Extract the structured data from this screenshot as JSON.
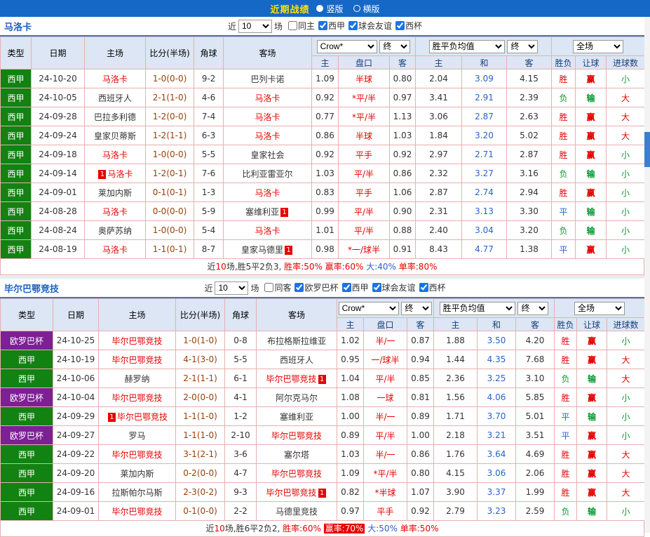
{
  "topbar": {
    "title": "近期战绩",
    "options": [
      {
        "label": "竖版",
        "selected": true
      },
      {
        "label": "横版",
        "selected": false
      }
    ]
  },
  "colors": {
    "accent_blue": "#1568c6",
    "league_green": "#128212",
    "league_purple": "#7c2093",
    "win_red": "#e60000",
    "lose_green": "#089a33",
    "draw_blue": "#2b62c9"
  },
  "sections": [
    {
      "team": "马洛卡",
      "filters": {
        "near": "近",
        "count": "10",
        "unit": "场",
        "checkboxes": [
          {
            "label": "同主",
            "checked": false
          },
          {
            "label": "西甲",
            "checked": true
          },
          {
            "label": "球会友谊",
            "checked": true
          },
          {
            "label": "西杯",
            "checked": true
          }
        ]
      },
      "header": {
        "type": "类型",
        "date": "日期",
        "home": "主场",
        "score": "比分(半场)",
        "corner": "角球",
        "away": "客场",
        "bookmaker": "Crow*",
        "bookmaker_stage": "终",
        "avg": "胜平负均值",
        "avg_stage": "终",
        "scope": "全场",
        "sub": [
          "主",
          "盘口",
          "客",
          "主",
          "和",
          "客",
          "胜负",
          "让球",
          "进球数"
        ]
      },
      "rows": [
        {
          "lg": "西甲",
          "lgc": "g",
          "date": "24-10-20",
          "home": {
            "name": "马洛卡",
            "focus": true
          },
          "score": "1-0(0-0)",
          "corner": "9-2",
          "away": {
            "name": "巴列卡诺"
          },
          "o": [
            "1.09",
            "半球",
            "0.80"
          ],
          "e": [
            "2.04",
            "3.09",
            "4.15"
          ],
          "res": [
            "胜",
            "r"
          ],
          "cov": [
            "赢",
            "r"
          ],
          "big": [
            "小",
            "g"
          ]
        },
        {
          "lg": "西甲",
          "lgc": "g",
          "date": "24-10-05",
          "home": {
            "name": "西班牙人"
          },
          "score": "2-1(1-0)",
          "corner": "4-6",
          "away": {
            "name": "马洛卡",
            "focus": true
          },
          "o": [
            "0.92",
            "*平/半",
            "0.97"
          ],
          "e": [
            "3.41",
            "2.91",
            "2.39"
          ],
          "res": [
            "负",
            "g"
          ],
          "cov": [
            "输",
            "g"
          ],
          "big": [
            "大",
            "r"
          ]
        },
        {
          "lg": "西甲",
          "lgc": "g",
          "date": "24-09-28",
          "home": {
            "name": "巴拉多利德"
          },
          "score": "1-2(0-0)",
          "corner": "7-4",
          "away": {
            "name": "马洛卡",
            "focus": true
          },
          "o": [
            "0.77",
            "*平/半",
            "1.13"
          ],
          "e": [
            "3.06",
            "2.87",
            "2.63"
          ],
          "res": [
            "胜",
            "r"
          ],
          "cov": [
            "赢",
            "r"
          ],
          "big": [
            "大",
            "r"
          ]
        },
        {
          "lg": "西甲",
          "lgc": "g",
          "date": "24-09-24",
          "home": {
            "name": "皇家贝蒂斯"
          },
          "score": "1-2(1-1)",
          "corner": "6-3",
          "away": {
            "name": "马洛卡",
            "focus": true
          },
          "o": [
            "0.86",
            "半球",
            "1.03"
          ],
          "e": [
            "1.84",
            "3.20",
            "5.02"
          ],
          "res": [
            "胜",
            "r"
          ],
          "cov": [
            "赢",
            "r"
          ],
          "big": [
            "大",
            "r"
          ]
        },
        {
          "lg": "西甲",
          "lgc": "g",
          "date": "24-09-18",
          "home": {
            "name": "马洛卡",
            "focus": true
          },
          "score": "1-0(0-0)",
          "corner": "5-5",
          "away": {
            "name": "皇家社会"
          },
          "o": [
            "0.92",
            "平手",
            "0.92"
          ],
          "e": [
            "2.97",
            "2.71",
            "2.87"
          ],
          "res": [
            "胜",
            "r"
          ],
          "cov": [
            "赢",
            "r"
          ],
          "big": [
            "小",
            "g"
          ]
        },
        {
          "lg": "西甲",
          "lgc": "g",
          "date": "24-09-14",
          "home": {
            "name": "马洛卡",
            "focus": true,
            "pre": "1"
          },
          "score": "1-2(0-1)",
          "corner": "7-6",
          "away": {
            "name": "比利亚雷亚尔"
          },
          "o": [
            "1.03",
            "平/半",
            "0.86"
          ],
          "e": [
            "2.32",
            "3.27",
            "3.16"
          ],
          "res": [
            "负",
            "g"
          ],
          "cov": [
            "输",
            "g"
          ],
          "big": [
            "小",
            "g"
          ]
        },
        {
          "lg": "西甲",
          "lgc": "g",
          "date": "24-09-01",
          "home": {
            "name": "莱加内斯"
          },
          "score": "0-1(0-1)",
          "corner": "1-3",
          "away": {
            "name": "马洛卡",
            "focus": true
          },
          "o": [
            "0.83",
            "平手",
            "1.06"
          ],
          "e": [
            "2.87",
            "2.74",
            "2.94"
          ],
          "res": [
            "胜",
            "r"
          ],
          "cov": [
            "赢",
            "r"
          ],
          "big": [
            "小",
            "g"
          ]
        },
        {
          "lg": "西甲",
          "lgc": "g",
          "date": "24-08-28",
          "home": {
            "name": "马洛卡",
            "focus": true
          },
          "score": "0-0(0-0)",
          "corner": "5-9",
          "away": {
            "name": "塞维利亚",
            "post": "1"
          },
          "o": [
            "0.99",
            "平/半",
            "0.90"
          ],
          "e": [
            "2.31",
            "3.13",
            "3.30"
          ],
          "res": [
            "平",
            "b"
          ],
          "cov": [
            "输",
            "g"
          ],
          "big": [
            "小",
            "g"
          ]
        },
        {
          "lg": "西甲",
          "lgc": "g",
          "date": "24-08-24",
          "home": {
            "name": "奥萨苏纳"
          },
          "score": "1-0(0-0)",
          "corner": "5-4",
          "away": {
            "name": "马洛卡",
            "focus": true
          },
          "o": [
            "1.01",
            "平/半",
            "0.88"
          ],
          "e": [
            "2.40",
            "3.04",
            "3.20"
          ],
          "res": [
            "负",
            "g"
          ],
          "cov": [
            "输",
            "g"
          ],
          "big": [
            "小",
            "g"
          ]
        },
        {
          "lg": "西甲",
          "lgc": "g",
          "date": "24-08-19",
          "home": {
            "name": "马洛卡",
            "focus": true
          },
          "score": "1-1(0-1)",
          "corner": "8-7",
          "away": {
            "name": "皇家马德里",
            "post": "1"
          },
          "o": [
            "0.98",
            "*一/球半",
            "0.91"
          ],
          "e": [
            "8.43",
            "4.77",
            "1.38"
          ],
          "res": [
            "平",
            "b"
          ],
          "cov": [
            "赢",
            "r"
          ],
          "big": [
            "小",
            "g"
          ]
        }
      ],
      "summary": [
        {
          "text": "近",
          "c": "k"
        },
        {
          "text": "10",
          "c": "r"
        },
        {
          "text": "场,胜5平2负3, ",
          "c": "k"
        },
        {
          "text": "胜率:50%",
          "c": "r"
        },
        {
          "text": " 赢率:60%",
          "c": "r"
        },
        {
          "text": " 大:40%",
          "c": "b"
        },
        {
          "text": " 单率:80%",
          "c": "r"
        }
      ]
    },
    {
      "team": "毕尔巴鄂竞技",
      "filters": {
        "near": "近",
        "count": "10",
        "unit": "场",
        "checkboxes": [
          {
            "label": "同客",
            "checked": false
          },
          {
            "label": "欧罗巴杯",
            "checked": true
          },
          {
            "label": "西甲",
            "checked": true
          },
          {
            "label": "球会友谊",
            "checked": true
          },
          {
            "label": "西杯",
            "checked": true
          }
        ]
      },
      "header": {
        "type": "类型",
        "date": "日期",
        "home": "主场",
        "score": "比分(半场)",
        "corner": "角球",
        "away": "客场",
        "bookmaker": "Crow*",
        "bookmaker_stage": "终",
        "avg": "胜平负均值",
        "avg_stage": "终",
        "scope": "全场",
        "sub": [
          "主",
          "盘口",
          "客",
          "主",
          "和",
          "客",
          "胜负",
          "让球",
          "进球数"
        ]
      },
      "rows": [
        {
          "lg": "欧罗巴杯",
          "lgc": "p",
          "date": "24-10-25",
          "home": {
            "name": "毕尔巴鄂竞技",
            "focus": true
          },
          "score": "1-0(1-0)",
          "corner": "0-8",
          "away": {
            "name": "布拉格斯拉维亚"
          },
          "o": [
            "1.02",
            "半/一",
            "0.87"
          ],
          "e": [
            "1.88",
            "3.50",
            "4.20"
          ],
          "res": [
            "胜",
            "r"
          ],
          "cov": [
            "赢",
            "r"
          ],
          "big": [
            "小",
            "g"
          ]
        },
        {
          "lg": "西甲",
          "lgc": "g",
          "date": "24-10-19",
          "home": {
            "name": "毕尔巴鄂竞技",
            "focus": true
          },
          "score": "4-1(3-0)",
          "corner": "5-5",
          "away": {
            "name": "西班牙人"
          },
          "o": [
            "0.95",
            "一/球半",
            "0.94"
          ],
          "e": [
            "1.44",
            "4.35",
            "7.68"
          ],
          "res": [
            "胜",
            "r"
          ],
          "cov": [
            "赢",
            "r"
          ],
          "big": [
            "大",
            "r"
          ]
        },
        {
          "lg": "西甲",
          "lgc": "g",
          "date": "24-10-06",
          "home": {
            "name": "赫罗纳"
          },
          "score": "2-1(1-1)",
          "corner": "6-1",
          "away": {
            "name": "毕尔巴鄂竞技",
            "focus": true,
            "post": "1"
          },
          "o": [
            "1.04",
            "平/半",
            "0.85"
          ],
          "e": [
            "2.36",
            "3.25",
            "3.10"
          ],
          "res": [
            "负",
            "g"
          ],
          "cov": [
            "输",
            "g"
          ],
          "big": [
            "大",
            "r"
          ]
        },
        {
          "lg": "欧罗巴杯",
          "lgc": "p",
          "date": "24-10-04",
          "home": {
            "name": "毕尔巴鄂竞技",
            "focus": true
          },
          "score": "2-0(0-0)",
          "corner": "4-1",
          "away": {
            "name": "阿尔克马尔"
          },
          "o": [
            "1.08",
            "一球",
            "0.81"
          ],
          "e": [
            "1.56",
            "4.06",
            "5.85"
          ],
          "res": [
            "胜",
            "r"
          ],
          "cov": [
            "赢",
            "r"
          ],
          "big": [
            "小",
            "g"
          ]
        },
        {
          "lg": "西甲",
          "lgc": "g",
          "date": "24-09-29",
          "home": {
            "name": "毕尔巴鄂竞技",
            "focus": true,
            "pre": "1"
          },
          "score": "1-1(1-0)",
          "corner": "1-2",
          "away": {
            "name": "塞维利亚"
          },
          "o": [
            "1.00",
            "半/一",
            "0.89"
          ],
          "e": [
            "1.71",
            "3.70",
            "5.01"
          ],
          "res": [
            "平",
            "b"
          ],
          "cov": [
            "输",
            "g"
          ],
          "big": [
            "小",
            "g"
          ]
        },
        {
          "lg": "欧罗巴杯",
          "lgc": "p",
          "date": "24-09-27",
          "home": {
            "name": "罗马"
          },
          "score": "1-1(1-0)",
          "corner": "2-10",
          "away": {
            "name": "毕尔巴鄂竞技",
            "focus": true
          },
          "o": [
            "0.89",
            "平/半",
            "1.00"
          ],
          "e": [
            "2.18",
            "3.21",
            "3.51"
          ],
          "res": [
            "平",
            "b"
          ],
          "cov": [
            "赢",
            "r"
          ],
          "big": [
            "小",
            "g"
          ]
        },
        {
          "lg": "西甲",
          "lgc": "g",
          "date": "24-09-22",
          "home": {
            "name": "毕尔巴鄂竞技",
            "focus": true
          },
          "score": "3-1(2-1)",
          "corner": "3-6",
          "away": {
            "name": "塞尔塔"
          },
          "o": [
            "1.03",
            "半/一",
            "0.86"
          ],
          "e": [
            "1.76",
            "3.64",
            "4.69"
          ],
          "res": [
            "胜",
            "r"
          ],
          "cov": [
            "赢",
            "r"
          ],
          "big": [
            "大",
            "r"
          ]
        },
        {
          "lg": "西甲",
          "lgc": "g",
          "date": "24-09-20",
          "home": {
            "name": "莱加内斯"
          },
          "score": "0-2(0-0)",
          "corner": "4-7",
          "away": {
            "name": "毕尔巴鄂竞技",
            "focus": true
          },
          "o": [
            "1.09",
            "*平/半",
            "0.80"
          ],
          "e": [
            "4.15",
            "3.06",
            "2.06"
          ],
          "res": [
            "胜",
            "r"
          ],
          "cov": [
            "赢",
            "r"
          ],
          "big": [
            "大",
            "r"
          ]
        },
        {
          "lg": "西甲",
          "lgc": "g",
          "date": "24-09-16",
          "home": {
            "name": "拉斯帕尔马斯"
          },
          "score": "2-3(0-2)",
          "corner": "9-3",
          "away": {
            "name": "毕尔巴鄂竞技",
            "focus": true,
            "post": "1"
          },
          "o": [
            "0.82",
            "*半球",
            "1.07"
          ],
          "e": [
            "3.90",
            "3.37",
            "1.99"
          ],
          "res": [
            "胜",
            "r"
          ],
          "cov": [
            "赢",
            "r"
          ],
          "big": [
            "大",
            "r"
          ]
        },
        {
          "lg": "西甲",
          "lgc": "g",
          "date": "24-09-01",
          "home": {
            "name": "毕尔巴鄂竞技",
            "focus": true
          },
          "score": "0-1(0-0)",
          "corner": "2-2",
          "away": {
            "name": "马德里竞技"
          },
          "o": [
            "0.97",
            "平手",
            "0.92"
          ],
          "e": [
            "2.79",
            "3.23",
            "2.59"
          ],
          "res": [
            "负",
            "g"
          ],
          "cov": [
            "输",
            "g"
          ],
          "big": [
            "小",
            "g"
          ]
        }
      ],
      "summary": [
        {
          "text": "近",
          "c": "k"
        },
        {
          "text": "10",
          "c": "r"
        },
        {
          "text": "场,胜6平2负2, ",
          "c": "k"
        },
        {
          "text": "胜率:60%",
          "c": "r"
        },
        {
          "text": " ",
          "c": "k"
        },
        {
          "text": "赢率:70%",
          "hl": true
        },
        {
          "text": " 大:50%",
          "c": "b"
        },
        {
          "text": " 单率:50%",
          "c": "r"
        }
      ]
    }
  ]
}
